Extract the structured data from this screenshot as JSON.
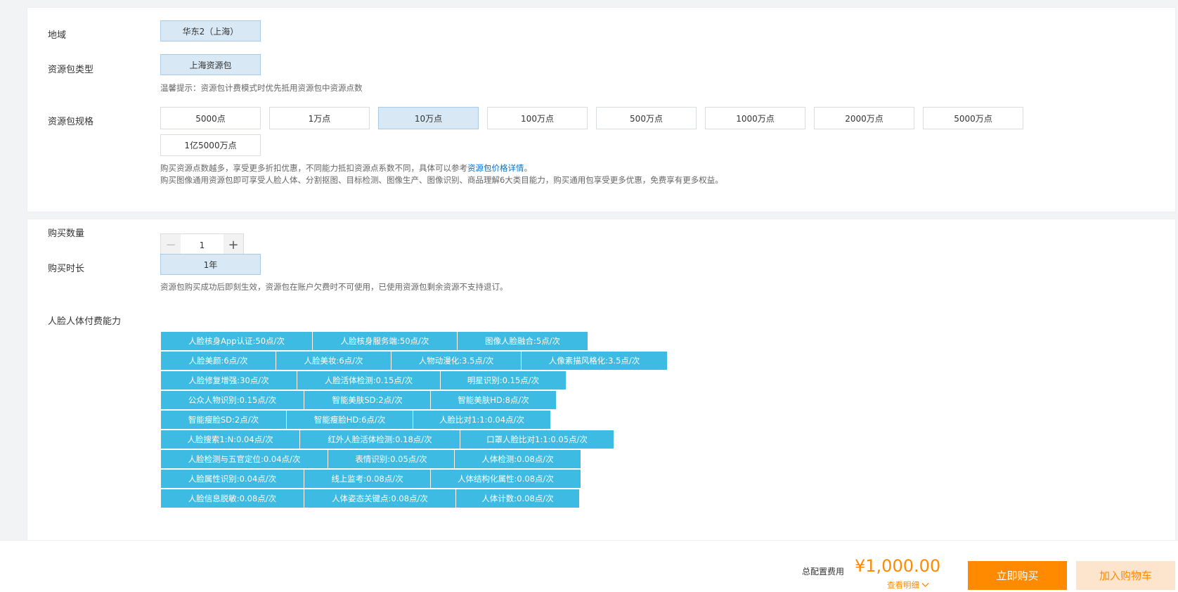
{
  "region": {
    "label": "地域",
    "option": "华东2（上海）"
  },
  "package_type": {
    "label": "资源包类型",
    "option": "上海资源包",
    "hint": "温馨提示：资源包计费模式时优先抵用资源包中资源点数"
  },
  "package_spec": {
    "label": "资源包规格",
    "options": [
      "5000点",
      "1万点",
      "10万点",
      "100万点",
      "500万点",
      "1000万点",
      "2000万点",
      "5000万点",
      "1亿5000万点"
    ],
    "selected": "10万点",
    "hint1_text": "购买资源点数越多，享受更多折扣优惠，不同能力抵扣资源点系数不同，具体可以参考",
    "hint1_link": "资源包价格详情",
    "hint1_end": "。",
    "hint2": "购买图像通用资源包即可享受人脸人体、分割抠图、目标检测、图像生产、图像识别、商品理解6大类目能力，购买通用包享受更多优惠，免费享有更多权益。"
  },
  "quantity": {
    "label": "购买数量",
    "value": "1",
    "minus": "−",
    "plus": "+"
  },
  "duration": {
    "label": "购买时长",
    "option": "1年",
    "hint": "资源包购买成功后即刻生效，资源包在账户欠费时不可使用，已使用资源包剩余资源不支持退订。"
  },
  "capabilities": {
    "label": "人脸人体付费能力",
    "rows": [
      [
        "人脸核身App认证:50点/次",
        "人脸核身服务端:50点/次",
        "图像人脸融合:5点/次"
      ],
      [
        "人脸美颜:6点/次",
        "人脸美妆:6点/次",
        "人物动漫化:3.5点/次",
        "人像素描风格化:3.5点/次"
      ],
      [
        "人脸修复增强:30点/次",
        "人脸活体检测:0.15点/次",
        "明星识别:0.15点/次"
      ],
      [
        "公众人物识别:0.15点/次",
        "智能美肤SD:2点/次",
        "智能美肤HD:8点/次"
      ],
      [
        "智能瘦脸SD:2点/次",
        "智能瘦脸HD:6点/次",
        "人脸比对1:1:0.04点/次"
      ],
      [
        "人脸搜索1:N:0.04点/次",
        "红外人脸活体检测:0.18点/次",
        "口罩人脸比对1:1:0.05点/次"
      ],
      [
        "人脸检测与五官定位:0.04点/次",
        "表情识别:0.05点/次",
        "人体检测:0.08点/次"
      ],
      [
        "人脸属性识别:0.04点/次",
        "线上监考:0.08点/次",
        "人体结构化属性:0.08点/次"
      ],
      [
        "人脸信息脱敏:0.08点/次",
        "人体姿态关键点:0.08点/次",
        "人体计数:0.08点/次"
      ]
    ]
  },
  "footer": {
    "total_label": "总配置费用",
    "price": "¥1,000.00",
    "detail_label": "查看明细",
    "buy_label": "立即购买",
    "cart_label": "加入购物车"
  },
  "colors": {
    "accent": "#ff8a00",
    "selected_bg": "#d8e8f4",
    "capability_bg": "#3ebbe2",
    "link": "#0070cc"
  }
}
